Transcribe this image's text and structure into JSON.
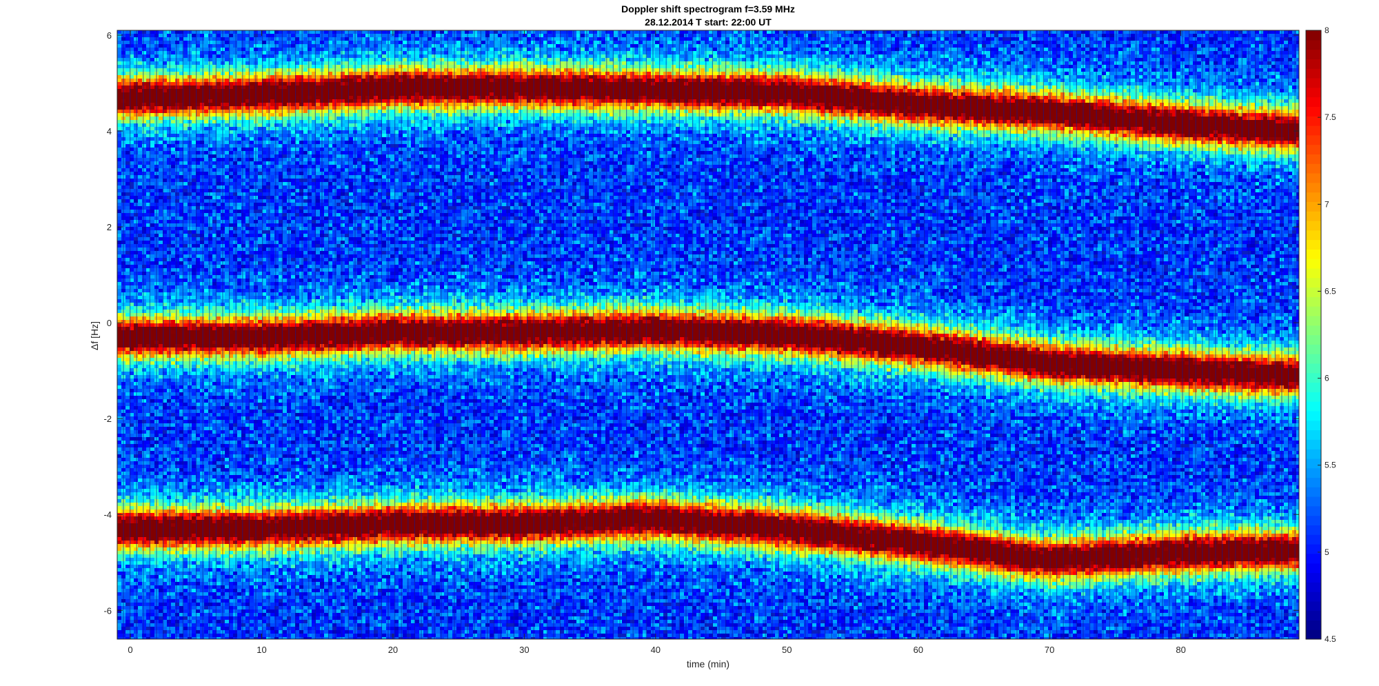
{
  "chart_data": {
    "type": "heatmap",
    "title": "Doppler shift spectrogram f=3.59 MHz",
    "subtitle": "28.12.2014   T start: 22:00 UT",
    "xlabel": "time (min)",
    "ylabel": "Δf [Hz]",
    "xlim": [
      -1,
      89
    ],
    "ylim": [
      -6.6,
      6.1
    ],
    "xticks": [
      0,
      10,
      20,
      30,
      40,
      50,
      60,
      70,
      80
    ],
    "yticks": [
      6,
      4,
      2,
      0,
      -2,
      -4,
      -6
    ],
    "colorbar": {
      "colormap": "jet",
      "range": [
        4.5,
        8
      ],
      "ticks": [
        8,
        7.5,
        7,
        6.5,
        6,
        5.5,
        5,
        4.5
      ]
    },
    "grid": false,
    "series": [
      {
        "x": [
          0,
          10,
          20,
          30,
          40,
          50,
          60,
          70,
          80,
          89
        ],
        "y": [
          4.7,
          4.75,
          4.9,
          4.9,
          4.85,
          4.8,
          4.55,
          4.4,
          4.15,
          4.0
        ]
      },
      {
        "x": [
          0,
          10,
          20,
          30,
          40,
          50,
          60,
          70,
          80,
          89
        ],
        "y": [
          -0.3,
          -0.3,
          -0.2,
          -0.2,
          -0.15,
          -0.25,
          -0.5,
          -0.85,
          -1.0,
          -1.1
        ]
      },
      {
        "x": [
          0,
          10,
          20,
          30,
          40,
          50,
          60,
          70,
          80,
          89
        ],
        "y": [
          -4.3,
          -4.3,
          -4.2,
          -4.2,
          -4.1,
          -4.3,
          -4.6,
          -4.95,
          -4.8,
          -4.75
        ]
      }
    ]
  }
}
